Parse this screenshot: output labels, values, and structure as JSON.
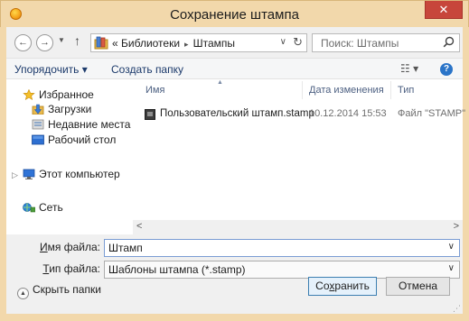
{
  "window": {
    "title": "Сохранение штампа",
    "close_glyph": "✕"
  },
  "nav": {
    "back_glyph": "←",
    "forward_glyph": "→",
    "recent_glyph": "▼",
    "up_glyph": "↑"
  },
  "address": {
    "prefix": "«",
    "segments": [
      "Библиотеки",
      "Штампы"
    ],
    "separator": "▸",
    "chevron_glyph": "∨",
    "refresh_glyph": "↻"
  },
  "search": {
    "placeholder": "Поиск: Штампы"
  },
  "toolbar": {
    "organize_label": "Упорядочить ▾",
    "new_folder_label": "Создать папку",
    "view_glyph": "☷ ▾",
    "help_glyph": "?"
  },
  "sidebar": {
    "items": [
      {
        "label": "Избранное",
        "icon": "star-icon"
      },
      {
        "label": "Загрузки",
        "icon": "downloads-icon"
      },
      {
        "label": "Недавние места",
        "icon": "recent-places-icon"
      },
      {
        "label": "Рабочий стол",
        "icon": "desktop-icon"
      },
      {
        "label": "Этот компьютер",
        "icon": "computer-icon"
      },
      {
        "label": "Сеть",
        "icon": "network-icon"
      }
    ],
    "expander_glyph": "▷"
  },
  "files": {
    "columns": [
      "Имя",
      "Дата изменения",
      "Тип"
    ],
    "sort_glyph": "▲",
    "rows": [
      {
        "name": "Пользовательский штамп.stamp",
        "date": "10.12.2014 15:53",
        "type": "Файл \"STAMP\""
      }
    ]
  },
  "scroll": {
    "left_glyph": "<",
    "right_glyph": ">"
  },
  "form": {
    "filename_label_accel": "И",
    "filename_label_rest": "мя файла:",
    "filename_value": "Штамп",
    "filetype_label_accel": "Т",
    "filetype_label_rest": "ип файла:",
    "filetype_value": "Шаблоны штампа (*.stamp)",
    "chevron_glyph": "∨"
  },
  "footer": {
    "hide_folders_label": "Скрыть папки",
    "hide_folders_glyph": "▲",
    "save_accel_before": "Со",
    "save_accel": "х",
    "save_accel_after": "ранить",
    "cancel_label": "Отмена",
    "grip_glyph": "⋰"
  }
}
